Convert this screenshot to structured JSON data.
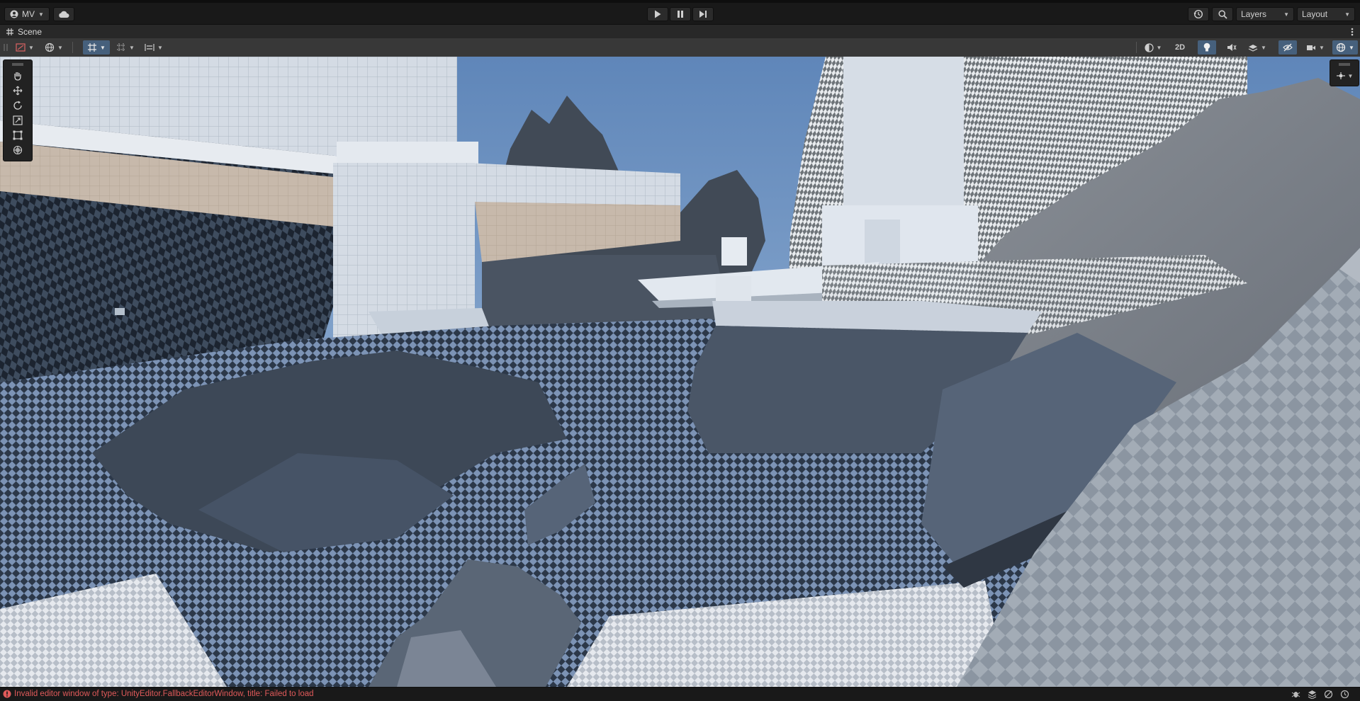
{
  "toolbar": {
    "account_label": "MV",
    "layers_label": "Layers",
    "layout_label": "Layout",
    "icons": [
      "account-icon",
      "cloud-icon",
      "play-icon",
      "pause-icon",
      "step-icon",
      "history-icon",
      "search-icon"
    ]
  },
  "scene_tab": {
    "title": "Scene"
  },
  "scene_toolbar": {
    "mode_2d_label": "2D"
  },
  "tools": [
    "hand-tool",
    "move-tool",
    "rotate-tool",
    "scale-tool",
    "rect-tool",
    "transform-tool"
  ],
  "status": {
    "message": "Invalid editor window of type: UnityEditor.FallbackEditorWindow, title: Failed to load"
  },
  "colors": {
    "sky_top": "#5f86b9",
    "sky_bottom": "#a8c2de",
    "error": "#e05a5a",
    "toggle_on": "#46607c"
  }
}
